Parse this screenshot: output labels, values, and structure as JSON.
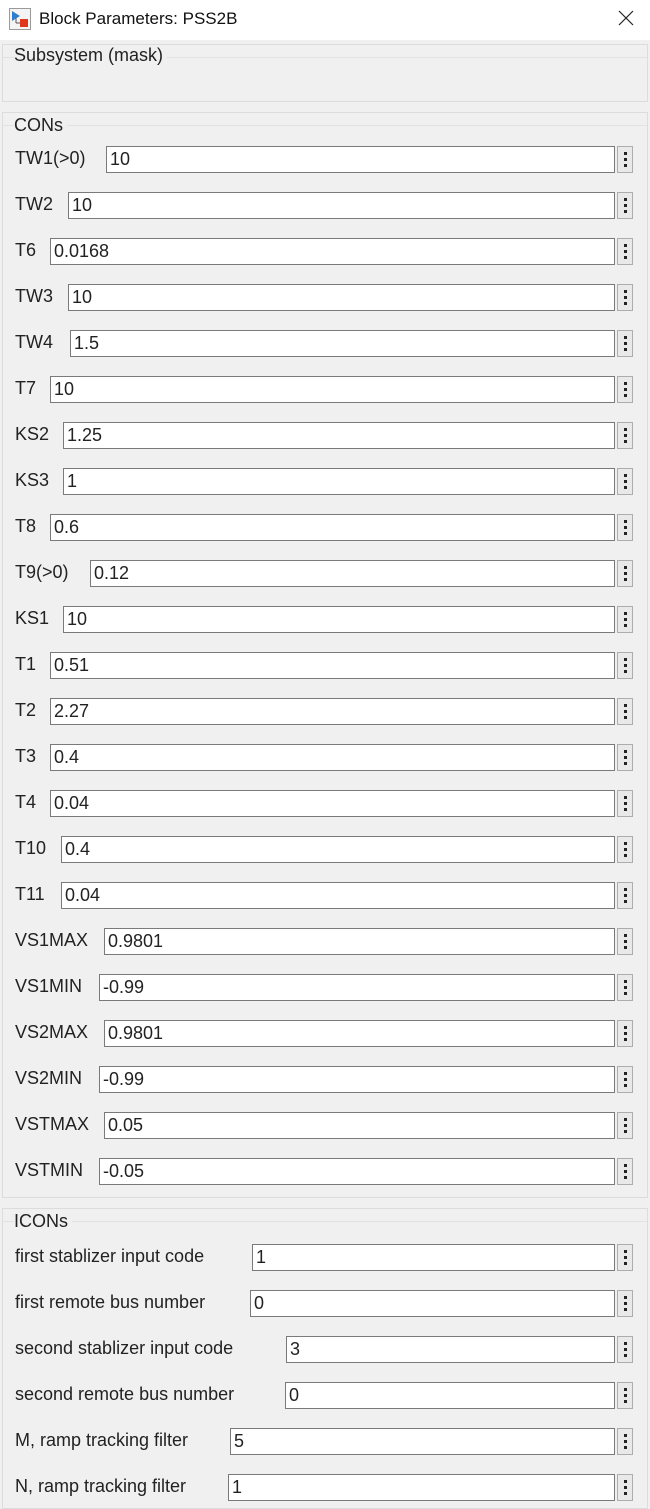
{
  "window": {
    "title": "Block Parameters: PSS2B",
    "app_icon": "simulink-block-icon",
    "close_icon": "close-icon"
  },
  "mask_group": {
    "title": "Subsystem (mask)"
  },
  "cons_group": {
    "title": "CONs",
    "params": [
      {
        "label": "TW1(>0)",
        "value": "10"
      },
      {
        "label": "TW2",
        "value": "10"
      },
      {
        "label": "T6",
        "value": "0.0168"
      },
      {
        "label": "TW3",
        "value": "10"
      },
      {
        "label": "TW4",
        "value": "1.5"
      },
      {
        "label": "T7",
        "value": "10"
      },
      {
        "label": "KS2",
        "value": "1.25"
      },
      {
        "label": "KS3",
        "value": "1"
      },
      {
        "label": "T8",
        "value": "0.6"
      },
      {
        "label": "T9(>0)",
        "value": "0.12"
      },
      {
        "label": "KS1",
        "value": "10"
      },
      {
        "label": "T1",
        "value": "0.51"
      },
      {
        "label": "T2",
        "value": "2.27"
      },
      {
        "label": "T3",
        "value": "0.4"
      },
      {
        "label": "T4",
        "value": "0.04"
      },
      {
        "label": "T10",
        "value": "0.4"
      },
      {
        "label": "T11",
        "value": "0.04"
      },
      {
        "label": "VS1MAX",
        "value": "0.9801"
      },
      {
        "label": "VS1MIN",
        "value": "-0.99"
      },
      {
        "label": "VS2MAX",
        "value": "0.9801"
      },
      {
        "label": "VS2MIN",
        "value": "-0.99"
      },
      {
        "label": "VSTMAX",
        "value": "0.05"
      },
      {
        "label": "VSTMIN",
        "value": "-0.05"
      }
    ]
  },
  "icons_group": {
    "title": "ICONs",
    "params": [
      {
        "label": "first stablizer input code",
        "value": "1"
      },
      {
        "label": "first remote bus number",
        "value": "0"
      },
      {
        "label": "second stablizer input code",
        "value": "3"
      },
      {
        "label": "second remote bus number",
        "value": "0"
      },
      {
        "label": "M, ramp tracking filter",
        "value": "5"
      },
      {
        "label": "N, ramp tracking filter",
        "value": "1"
      }
    ]
  }
}
